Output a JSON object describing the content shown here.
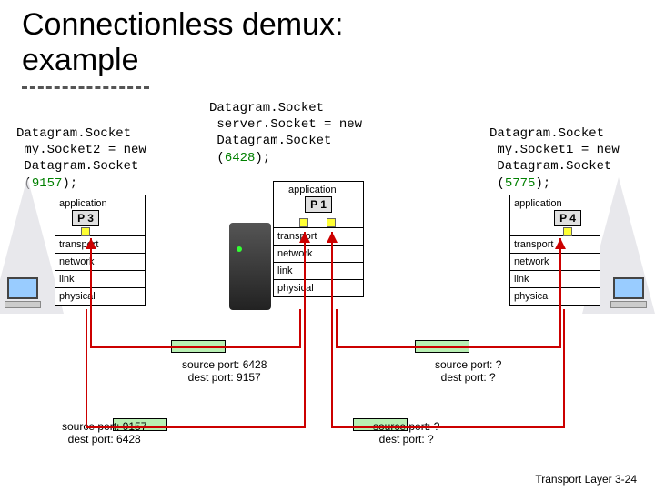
{
  "title_line1": "Connectionless demux:",
  "title_line2": "example",
  "code": {
    "left": "Datagram.Socket\n my.Socket2 = new\n Datagram.Socket\n (",
    "left_port": "9157",
    "left_end": ");",
    "center": "Datagram.Socket\n server.Socket = new\n Datagram.Socket\n (",
    "center_port": "6428",
    "center_end": ");",
    "right": "Datagram.Socket\n my.Socket1 = new\n Datagram.Socket\n (",
    "right_port": "5775",
    "right_end": ");"
  },
  "layers": {
    "application": "application",
    "transport": "transport",
    "network": "network",
    "link": "link",
    "physical": "physical"
  },
  "procs": {
    "p1": "P 1",
    "p3": "P 3",
    "p4": "P 4"
  },
  "labels": {
    "bl1": "source port: 9157",
    "bl2": "dest port: 6428",
    "tl1": "source port: 6428",
    "tl2": "dest port: 9157",
    "tr1": "source port: ?",
    "tr2": "dest port: ?",
    "br1": "source port: ?",
    "br2": "dest port: ?"
  },
  "footer_text": "Transport Layer",
  "footer_page": "3-24"
}
